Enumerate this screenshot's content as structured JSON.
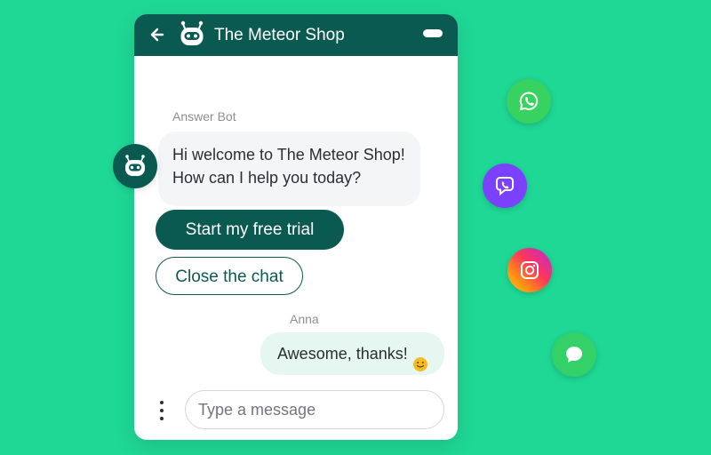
{
  "app": {
    "title": "The Meteor Shop"
  },
  "header": {
    "back_icon": "back-arrow-icon",
    "bot_icon": "robot-icon",
    "menu_icon": "pill-toggle-icon"
  },
  "bot": {
    "name": "Answer Bot",
    "message_lines": [
      "Hi welcome to The Meteor Shop!",
      "How can I help you today?"
    ],
    "avatar_icon": "robot-icon"
  },
  "actions": {
    "primary_label": "Start my free trial",
    "secondary_label": "Close the chat"
  },
  "user": {
    "name": "Anna",
    "message": "Awesome, thanks!",
    "emoji_icon": "smiling-face-icon"
  },
  "composer": {
    "placeholder": "Type a message",
    "more_icon": "more-vertical-icon"
  },
  "channels": [
    {
      "name": "WhatsApp",
      "icon": "whatsapp-icon"
    },
    {
      "name": "Viber",
      "icon": "viber-icon"
    },
    {
      "name": "Instagram",
      "icon": "instagram-icon"
    },
    {
      "name": "Messages",
      "icon": "chat-bubble-icon"
    }
  ],
  "colors": {
    "background": "#1fd896",
    "header": "#0b5a52",
    "user_bubble": "#e6f7f1",
    "bot_bubble": "#f3f5f6",
    "button_dark": "#0b5a52"
  }
}
